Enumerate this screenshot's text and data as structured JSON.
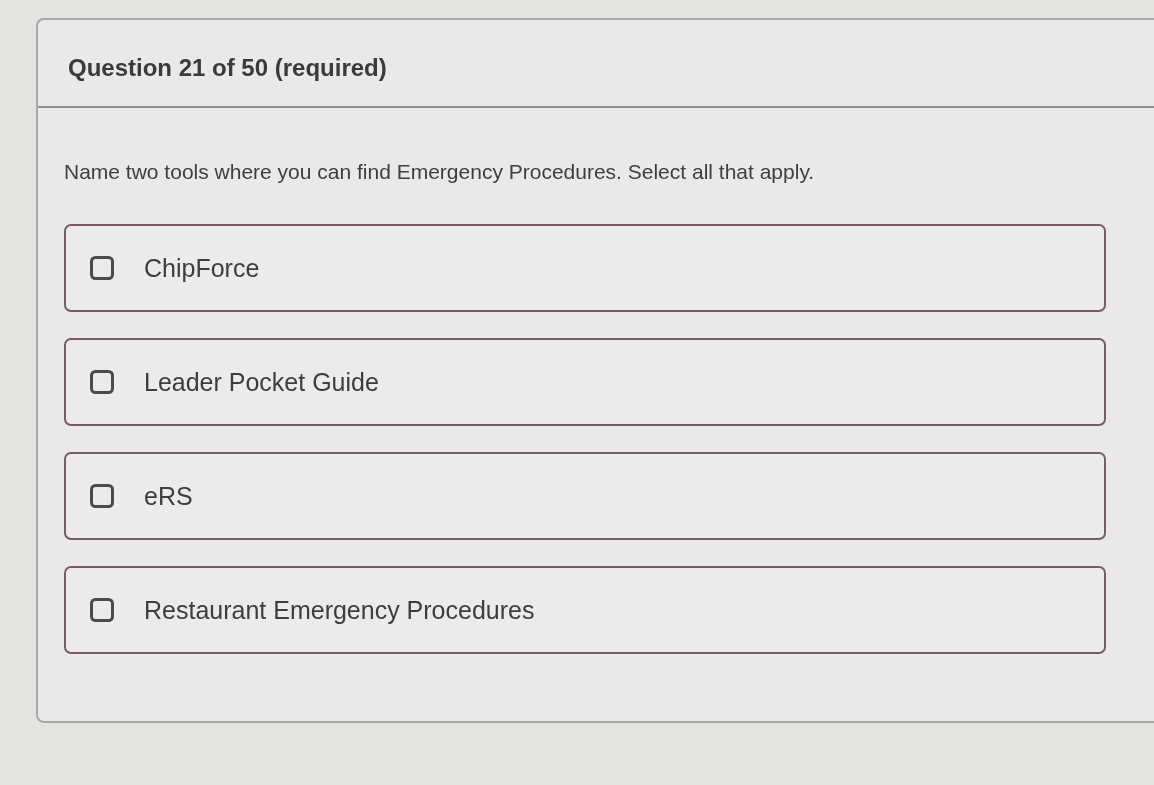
{
  "question": {
    "title": "Question 21 of 50 (required)",
    "prompt": "Name two tools where you can find Emergency Procedures. Select all that apply.",
    "options": [
      {
        "label": "ChipForce",
        "checked": false
      },
      {
        "label": "Leader Pocket Guide",
        "checked": false
      },
      {
        "label": "eRS",
        "checked": false
      },
      {
        "label": "Restaurant Emergency Procedures",
        "checked": false
      }
    ]
  }
}
